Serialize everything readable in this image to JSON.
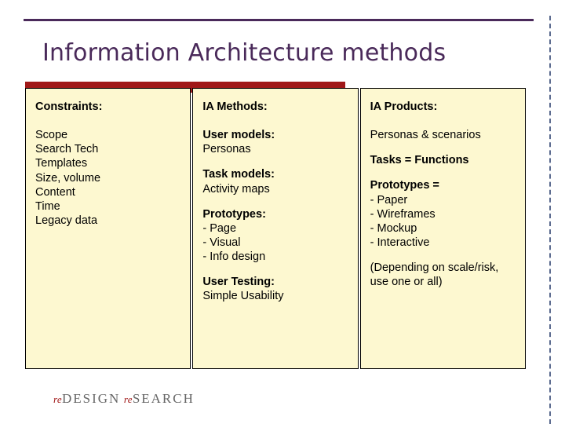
{
  "title": "Information Architecture methods",
  "columns": {
    "constraints": {
      "heading": "Constraints:",
      "items": [
        "Scope",
        "Search Tech",
        "Templates",
        "Size, volume",
        "Content",
        "Time",
        "Legacy data"
      ]
    },
    "methods": {
      "heading": "IA Methods:",
      "blocks": {
        "user_models": {
          "title": "User models:",
          "body": "Personas"
        },
        "task_models": {
          "title": "Task models:",
          "body": "Activity maps"
        },
        "prototypes": {
          "title": "Prototypes:",
          "items": [
            "Page",
            "Visual",
            "Info design"
          ]
        },
        "user_testing": {
          "title": "User Testing:",
          "body": "Simple Usability"
        }
      }
    },
    "products": {
      "heading": "IA Products:",
      "line1": "Personas & scenarios",
      "line2": "Tasks = Functions",
      "proto_title": "Prototypes =",
      "proto_items": [
        "Paper",
        "Wireframes",
        "Mockup",
        "Interactive"
      ],
      "note": "(Depending on scale/risk, use one or all)"
    }
  },
  "logo": {
    "re1": "re",
    "design": "DESIGN",
    "re2": "re",
    "search": "SEARCH"
  }
}
